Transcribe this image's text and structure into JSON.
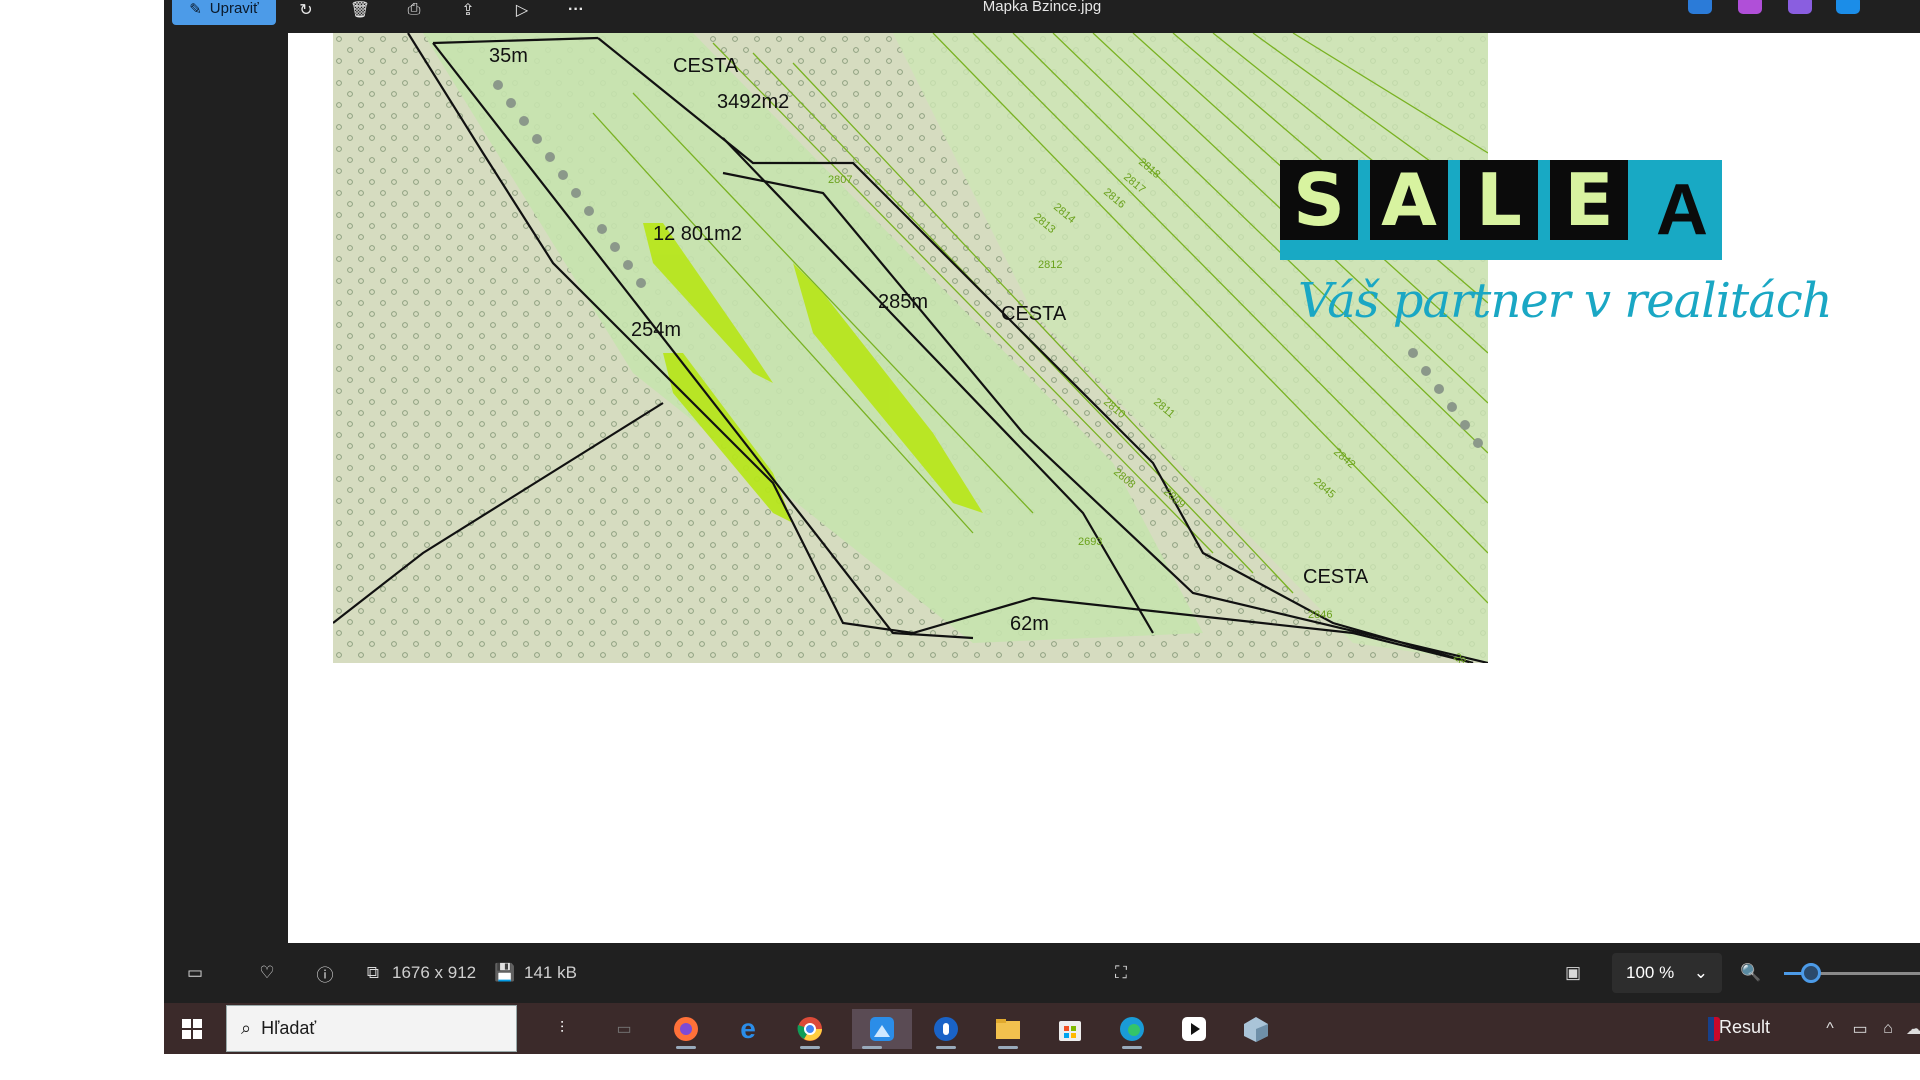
{
  "toolbar": {
    "edit_label": "Upraviť",
    "title": "Mapka Bzince.jpg",
    "more_label": "···"
  },
  "image": {
    "labels": {
      "top_width": "35m",
      "cesta_top": "CESTA",
      "area_small": "3492m2",
      "area_large": "12 801m2",
      "length_right": "285m",
      "cesta_mid": "CESTA",
      "length_left": "254m",
      "cesta_bottom": "CESTA",
      "bottom_width": "62m"
    },
    "parcel_numbers": [
      "2807",
      "2818",
      "2817",
      "2816",
      "2814",
      "2813",
      "2812",
      "2811",
      "2810",
      "2809",
      "2808",
      "2693",
      "2845",
      "2842",
      "2846",
      "2844"
    ]
  },
  "logo": {
    "letters": [
      "S",
      "A",
      "L",
      "E",
      "A"
    ],
    "tagline": "Váš partner v realitách",
    "color_brand": "#18a9c4"
  },
  "statusbar": {
    "dimensions": "1676 x 912",
    "filesize": "141 kB",
    "zoom": "100 %",
    "zoom_level": 0.2
  },
  "taskbar": {
    "search_placeholder": "Hľadať",
    "result_label": "Result"
  }
}
